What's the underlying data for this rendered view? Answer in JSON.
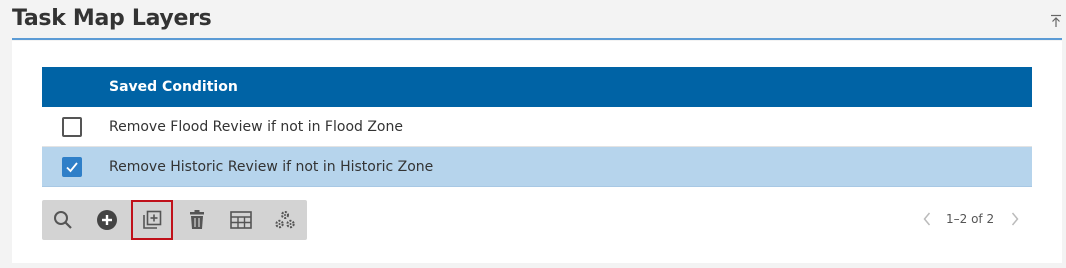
{
  "header": {
    "title": "Task Map Layers"
  },
  "table": {
    "column_header": "Saved Condition",
    "rows": [
      {
        "label": "Remove Flood Review if not in Flood Zone",
        "checked": false
      },
      {
        "label": "Remove Historic Review if not in Historic Zone",
        "checked": true
      }
    ]
  },
  "toolbar": {
    "tools": [
      "search-icon",
      "add-icon",
      "duplicate-icon",
      "delete-icon",
      "table-icon",
      "settings-icon"
    ],
    "active_tool": "duplicate-icon"
  },
  "pager": {
    "text": "1–2 of 2"
  },
  "colors": {
    "header": "#0063a5",
    "selected_row": "#b6d4ec",
    "accent_line": "#5b9bd5",
    "checkbox": "#2f7fc8",
    "highlight": "#c0111a"
  }
}
